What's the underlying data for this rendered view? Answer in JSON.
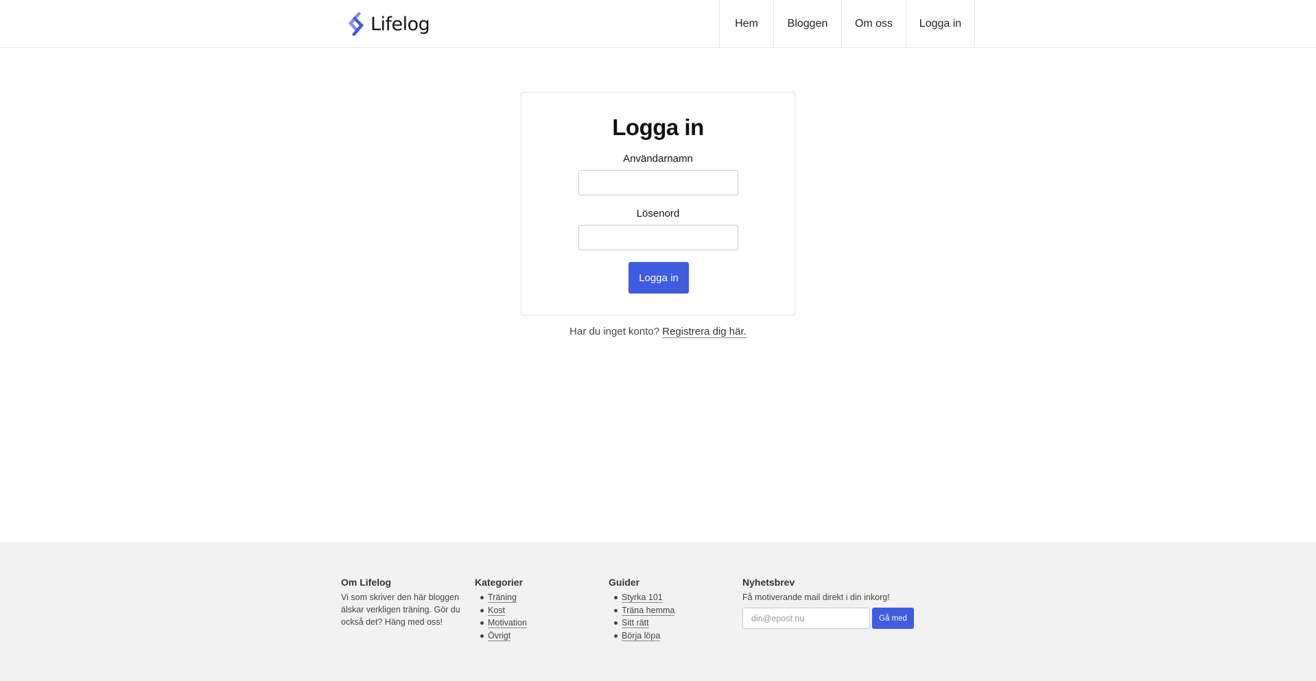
{
  "header": {
    "brand": "Lifelog",
    "nav": [
      {
        "label": "Hem"
      },
      {
        "label": "Bloggen"
      },
      {
        "label": "Om oss"
      },
      {
        "label": "Logga in"
      }
    ]
  },
  "login": {
    "title": "Logga in",
    "username_label": "Användarnamn",
    "username_value": "",
    "password_label": "Lösenord",
    "password_value": "",
    "submit_label": "Logga in",
    "register_prompt": "Har du inget konto?",
    "register_link": "Registrera dig här."
  },
  "footer": {
    "about": {
      "title": "Om Lifelog",
      "text": "Vi som skriver den här bloggen älskar verkligen träning. Gör du också det? Häng med oss!"
    },
    "categories": {
      "title": "Kategorier",
      "items": [
        "Träning",
        "Kost",
        "Motivation",
        "Övrigt"
      ]
    },
    "guides": {
      "title": "Guider",
      "items": [
        "Styrka 101",
        "Träna hemma",
        "Sitt rätt",
        "Börja löpa"
      ]
    },
    "newsletter": {
      "title": "Nyhetsbrev",
      "text": "Få motiverande mail direkt i din inkorg!",
      "email_placeholder": "din@epost.nu",
      "email_value": "",
      "button_label": "Gå med"
    }
  },
  "colors": {
    "accent": "#3f5be0",
    "logo_light": "#7b8ff0",
    "footer_bg": "#f2f2f2"
  },
  "icons": {
    "logo": "lifelog-chevron-logo-icon"
  }
}
